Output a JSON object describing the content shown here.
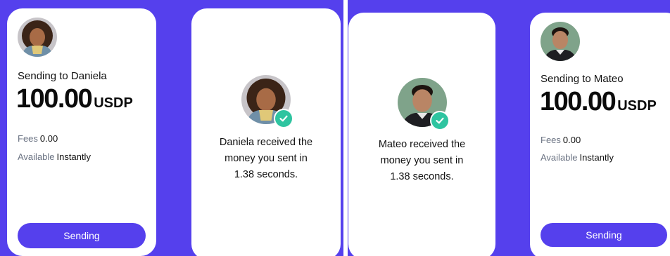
{
  "colors": {
    "brand": "#5540ed",
    "success": "#2ec4a0",
    "card": "#ffffff",
    "muted": "#6b7383"
  },
  "left_panel": {
    "send_card": {
      "avatar_icon": "daniela-avatar",
      "title": "Sending to Daniela",
      "amount": "100.00",
      "currency": "USDP",
      "fees_label": "Fees",
      "fees_value": "0.00",
      "available_label": "Available",
      "available_value": "Instantly",
      "button_label": "Sending"
    },
    "receipt_card": {
      "avatar_icon": "daniela-avatar",
      "status_icon": "check-icon",
      "message_lines": [
        "Daniela received the",
        "money you sent in",
        "1.38 seconds."
      ]
    }
  },
  "right_panel": {
    "receipt_card": {
      "avatar_icon": "mateo-avatar",
      "status_icon": "check-icon",
      "message_lines": [
        "Mateo received the",
        "money you sent in",
        "1.38 seconds."
      ]
    },
    "send_card": {
      "avatar_icon": "mateo-avatar",
      "title": "Sending to Mateo",
      "amount": "100.00",
      "currency": "USDP",
      "fees_label": "Fees",
      "fees_value": "0.00",
      "available_label": "Available",
      "available_value": "Instantly",
      "button_label": "Sending"
    }
  }
}
